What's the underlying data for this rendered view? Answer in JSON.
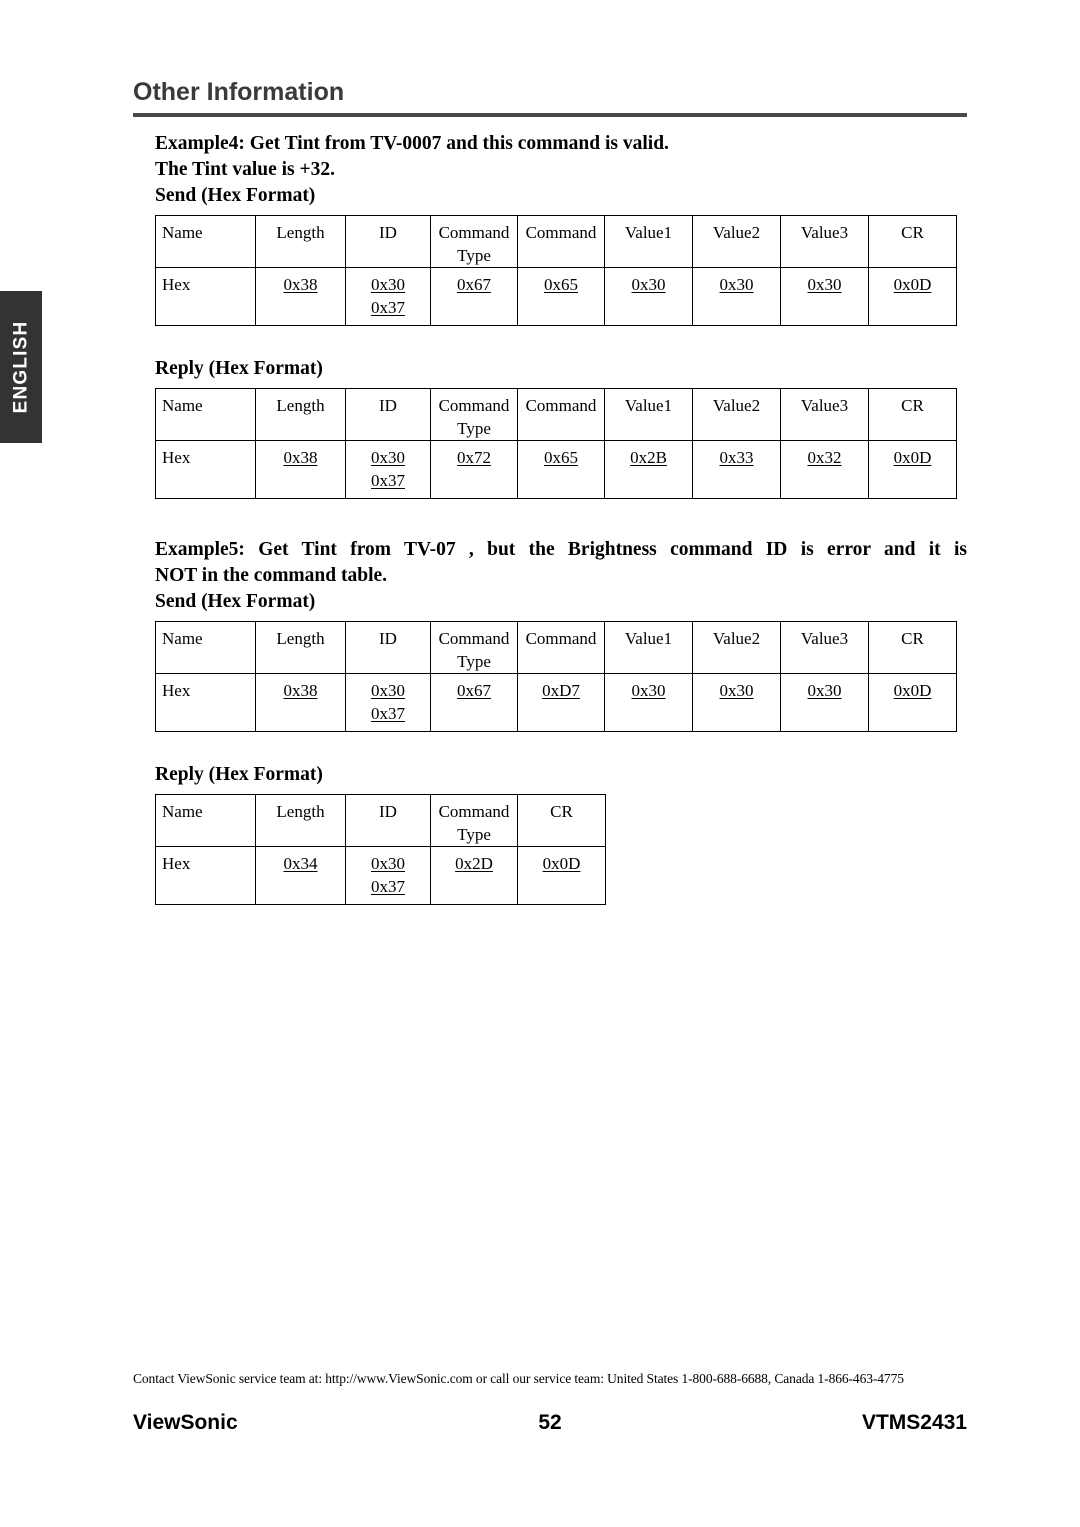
{
  "language_tab": {
    "label": "ENGLISH"
  },
  "header": {
    "title": "Other Information"
  },
  "sections": [
    {
      "heading_lines": [
        "Example4: Get Tint from TV-0007 and this command is valid.",
        "The Tint value is +32."
      ],
      "send_label": "Send (Hex Format)",
      "send_table": {
        "headers": [
          "Name",
          "Length",
          "ID",
          "Command Type",
          "Command",
          "Value1",
          "Value2",
          "Value3",
          "CR"
        ],
        "header_ctype_line1": "Command",
        "header_ctype_line2": "Type",
        "row_label": "Hex",
        "values": [
          "0x38",
          [
            "0x30",
            "0x37"
          ],
          "0x67",
          "0x65",
          "0x30",
          "0x30",
          "0x30",
          "0x0D"
        ]
      },
      "reply_label": "Reply (Hex Format)",
      "reply_table": {
        "headers": [
          "Name",
          "Length",
          "ID",
          "Command Type",
          "Command",
          "Value1",
          "Value2",
          "Value3",
          "CR"
        ],
        "header_ctype_line1": "Command",
        "header_ctype_line2": "Type",
        "row_label": "Hex",
        "values": [
          "0x38",
          [
            "0x30",
            "0x37"
          ],
          "0x72",
          "0x65",
          "0x2B",
          "0x33",
          "0x32",
          "0x0D"
        ]
      }
    },
    {
      "heading_lines": [
        "Example5: Get Tint from TV-07 , but the Brightness command ID is error and it is",
        "NOT in the command table."
      ],
      "send_label": "Send (Hex Format)",
      "send_table": {
        "headers": [
          "Name",
          "Length",
          "ID",
          "Command Type",
          "Command",
          "Value1",
          "Value2",
          "Value3",
          "CR"
        ],
        "header_ctype_line1": "Command",
        "header_ctype_line2": "Type",
        "row_label": "Hex",
        "values": [
          "0x38",
          [
            "0x30",
            "0x37"
          ],
          "0x67",
          "0xD7",
          "0x30",
          "0x30",
          "0x30",
          "0x0D"
        ]
      },
      "reply_label": "Reply (Hex Format)",
      "reply_table": {
        "headers": [
          "Name",
          "Length",
          "ID",
          "Command Type",
          "CR"
        ],
        "header_ctype_line1": "Command",
        "header_ctype_line2": "Type",
        "row_label": "Hex",
        "values": [
          "0x34",
          [
            "0x30",
            "0x37"
          ],
          "0x2D",
          "0x0D"
        ]
      }
    }
  ],
  "footer": {
    "contact": "Contact ViewSonic service team at: http://www.ViewSonic.com or call our service team: United States 1-800-688-6688, Canada 1-866-463-4775",
    "brand": "ViewSonic",
    "page_number": "52",
    "model": "VTMS2431"
  },
  "colors": {
    "tab_background": "#333333",
    "title_text": "#3a3a3a",
    "rule": "#4a4a4a",
    "body_text": "#000000"
  }
}
